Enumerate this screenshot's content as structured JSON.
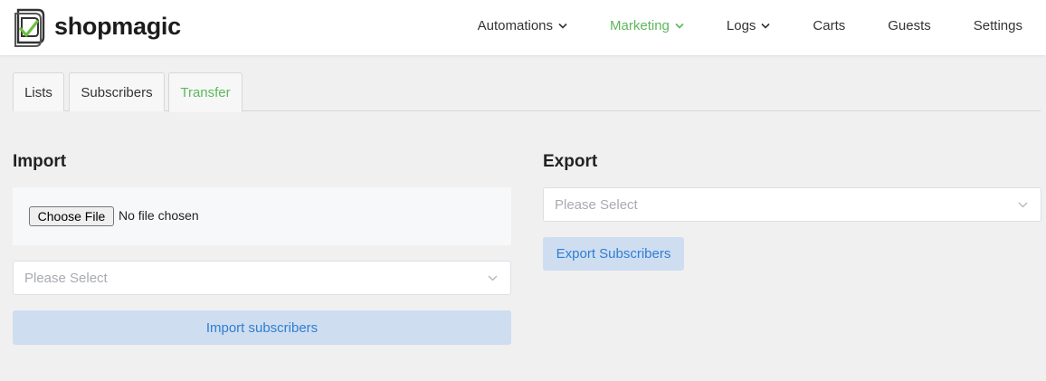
{
  "app": {
    "logo_text": "shopmagic"
  },
  "colors": {
    "accent_green": "#5cb85c",
    "button_bg": "#cfddf1",
    "button_text": "#2f7fd0"
  },
  "nav": {
    "items": [
      {
        "label": "Automations",
        "has_dropdown": true,
        "active": false
      },
      {
        "label": "Marketing",
        "has_dropdown": true,
        "active": true
      },
      {
        "label": "Logs",
        "has_dropdown": true,
        "active": false
      },
      {
        "label": "Carts",
        "has_dropdown": false,
        "active": false
      },
      {
        "label": "Guests",
        "has_dropdown": false,
        "active": false
      },
      {
        "label": "Settings",
        "has_dropdown": false,
        "active": false
      }
    ]
  },
  "tabs": [
    {
      "label": "Lists",
      "active": false
    },
    {
      "label": "Subscribers",
      "active": false
    },
    {
      "label": "Transfer",
      "active": true
    }
  ],
  "import": {
    "title": "Import",
    "file_button": "Choose File",
    "file_status": "No file chosen",
    "select_placeholder": "Please Select",
    "submit_label": "Import subscribers"
  },
  "export": {
    "title": "Export",
    "select_placeholder": "Please Select",
    "submit_label": "Export Subscribers"
  }
}
